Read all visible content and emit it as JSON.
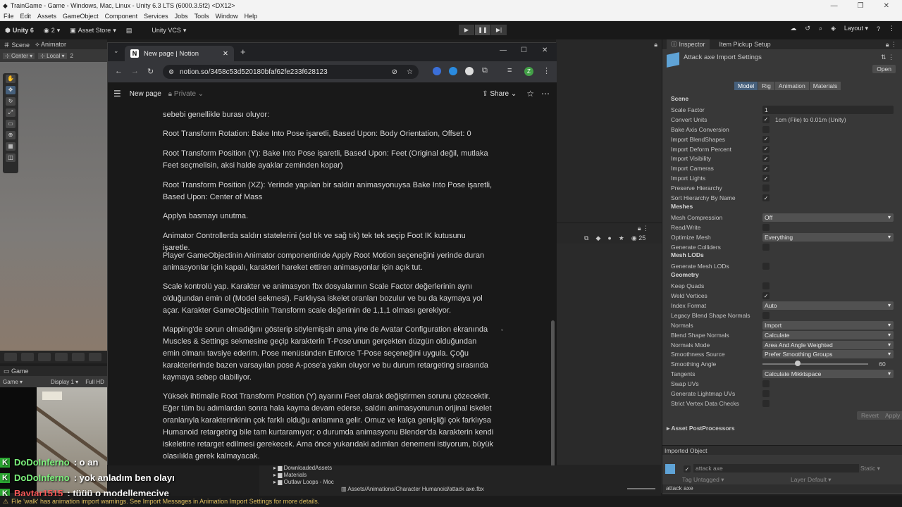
{
  "unity": {
    "window_title": "TrainGame - Game - Windows, Mac, Linux - Unity 6.3 LTS (6000.3.5f2) <DX12>",
    "menu": [
      "File",
      "Edit",
      "Assets",
      "GameObject",
      "Component",
      "Services",
      "Jobs",
      "Tools",
      "Window",
      "Help"
    ],
    "toolbar": {
      "unity6": "Unity 6",
      "users_count": "2",
      "asset_store": "Asset Store",
      "vcs": "Unity VCS",
      "layout": "Layout"
    },
    "scene_tabs": [
      "Scene",
      "Animator"
    ],
    "scene_tools": [
      "Center",
      "Local",
      "2"
    ],
    "game_tab": "Game",
    "game_bar": [
      "Game",
      "Display 1",
      "Full HD"
    ],
    "status_message": "File 'walk' has animation import warnings. See Import Messages in Animation Import Settings for more details.",
    "project": {
      "folders": [
        "DownloadedAssets",
        "Materials",
        "Outlaw Loops - Moc"
      ],
      "path": "Assets/Animations/Character Humanoid/attack axe.fbx",
      "search_count": "25"
    }
  },
  "chat": [
    {
      "user": "DoDoInferno",
      "message": ": o an"
    },
    {
      "user": "DoDoInferno",
      "message": ": yok anladım ben olayı"
    },
    {
      "user": "Baytar1515",
      "message": ": tüüü o modellemeciye"
    }
  ],
  "browser": {
    "tab_title": "New page | Notion",
    "url": "notion.so/3458c53d520180bfaf62fe233f628123",
    "profile_initial": "Z",
    "notion": {
      "page_title": "New page",
      "privacy": "Private",
      "share_label": "Share",
      "paragraphs": [
        "sebebi genellikle burası oluyor:",
        "Root Transform Rotation: Bake Into Pose işaretli, Based Upon: Body Orientation, Offset: 0",
        "Root Transform Position (Y): Bake Into Pose işaretli, Based Upon: Feet (Original değil, mutlaka Feet seçmelisin, aksi halde ayaklar zeminden kopar)",
        "Root Transform Position (XZ): Yerinde yapılan bir saldırı animasyonuysa Bake Into Pose işaretli, Based Upon: Center of Mass",
        "Applya basmayı unutma.",
        "Animator Controllerda saldırı statelerini (sol tık ve sağ tık) tek tek seçip Foot IK kutusunu işaretle.",
        "Player GameObjectinin Animator componentinde Apply Root Motion seçeneğini yerinde duran animasyonlar için kapalı, karakteri hareket ettiren animasyonlar için açık tut.",
        "Scale kontrolü yap. Karakter ve animasyon fbx dosyalarının Scale Factor değerlerinin aynı olduğundan emin ol (Model sekmesi). Farklıysa iskelet oranları bozulur ve bu da kaymaya yol açar. Karakter GameObjectinin Transform scale değerinin de 1,1,1 olması gerekiyor.",
        "Mapping'de sorun olmadığını gösterip söylemişsin ama yine de Avatar Configuration ekranında Muscles & Settings sekmesine geçip karakterin T-Pose'unun gerçekten düzgün olduğundan emin olmanı tavsiye ederim. Pose menüsünden Enforce T-Pose seçeneğini uygula. Çoğu karakterlerinde bazen varsayılan pose A-pose'a yakın oluyor ve bu durum retargeting sırasında kaymaya sebep olabiliyor.",
        "Yüksek ihtimalle Root Transform Position (Y) ayarını Feet olarak değiştirmen sorunu çözecektir. Eğer tüm bu adımlardan sonra hala kayma devam ederse, saldırı animasyonunun orijinal iskelet oranlarıyla karakterinkinin çok farklı olduğu anlamına gelir. Omuz ve kalça genişliği çok farklıysa Humanoid retargeting bile tam kurtaramıyor; o durumda animasyonu Blender'da karakterin kendi iskeletine retarget edilmesi gerekecek. Ama önce yukarıdaki adımları denemeni istiyorum, büyük olasılıkla gerek kalmayacak."
      ]
    }
  },
  "inspector": {
    "tabs": [
      "Inspector",
      "Item Pickup Setup"
    ],
    "title": "Attack axe Import Settings",
    "open_label": "Open",
    "subtabs": [
      "Model",
      "Rig",
      "Animation",
      "Materials"
    ],
    "active_subtab": "Model",
    "rows": [
      {
        "type": "header",
        "label": "Scene"
      },
      {
        "type": "field",
        "label": "Scale Factor",
        "value": "1"
      },
      {
        "type": "check",
        "label": "Convert Units",
        "checked": true,
        "extra": "1cm (File) to 0.01m (Unity)"
      },
      {
        "type": "check",
        "label": "Bake Axis Conversion",
        "checked": false
      },
      {
        "type": "check",
        "label": "Import BlendShapes",
        "checked": true
      },
      {
        "type": "check",
        "label": "Import Deform Percent",
        "checked": true
      },
      {
        "type": "check",
        "label": "Import Visibility",
        "checked": true
      },
      {
        "type": "check",
        "label": "Import Cameras",
        "checked": true
      },
      {
        "type": "check",
        "label": "Import Lights",
        "checked": true
      },
      {
        "type": "check",
        "label": "Preserve Hierarchy",
        "checked": false
      },
      {
        "type": "check",
        "label": "Sort Hierarchy By Name",
        "checked": true
      },
      {
        "type": "header",
        "label": "Meshes"
      },
      {
        "type": "dropdown",
        "label": "Mesh Compression",
        "value": "Off"
      },
      {
        "type": "check",
        "label": "Read/Write",
        "checked": false
      },
      {
        "type": "dropdown",
        "label": "Optimize Mesh",
        "value": "Everything"
      },
      {
        "type": "check",
        "label": "Generate Colliders",
        "checked": false
      },
      {
        "type": "header",
        "label": "Mesh LODs"
      },
      {
        "type": "check",
        "label": "Generate Mesh LODs",
        "checked": false
      },
      {
        "type": "header",
        "label": "Geometry"
      },
      {
        "type": "check",
        "label": "Keep Quads",
        "checked": false
      },
      {
        "type": "check",
        "label": "Weld Vertices",
        "checked": true
      },
      {
        "type": "dropdown",
        "label": "Index Format",
        "value": "Auto"
      },
      {
        "type": "check",
        "label": "Legacy Blend Shape Normals",
        "checked": false
      },
      {
        "type": "dropdown",
        "label": "Normals",
        "value": "Import"
      },
      {
        "type": "dropdown",
        "label": "Blend Shape Normals",
        "value": "Calculate"
      },
      {
        "type": "dropdown",
        "label": "Normals Mode",
        "value": "Area And Angle Weighted"
      },
      {
        "type": "dropdown",
        "label": "Smoothness Source",
        "value": "Prefer Smoothing Groups"
      },
      {
        "type": "slider",
        "label": "Smoothing Angle",
        "value": "60",
        "fraction": 0.333
      },
      {
        "type": "dropdown",
        "label": "Tangents",
        "value": "Calculate Mikktspace"
      },
      {
        "type": "check",
        "label": "Swap UVs",
        "checked": false
      },
      {
        "type": "check",
        "label": "Generate Lightmap UVs",
        "checked": false
      },
      {
        "type": "check",
        "label": "Strict Vertex Data Checks",
        "checked": false
      }
    ],
    "revert_label": "Revert",
    "apply_label": "Apply",
    "asset_postprocessors": "Asset PostProcessors",
    "imported_object": {
      "section": "Imported Object",
      "name": "attack axe",
      "static": "Static",
      "tag_label": "Tag",
      "tag_value": "Untagged",
      "layer_label": "Layer",
      "layer_value": "Default",
      "footer_name": "attack axe"
    }
  },
  "colors": {
    "unity_dark": "#383838",
    "notion_bg": "#191919",
    "selection_blue": "#46607c",
    "chat_green": "#2ba632"
  }
}
